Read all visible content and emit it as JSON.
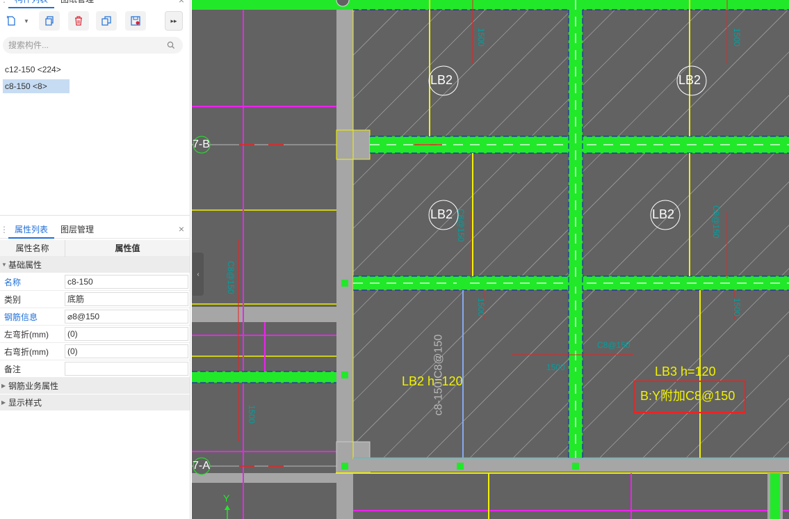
{
  "top_panel": {
    "tabs": [
      "构件列表",
      "图纸管理"
    ],
    "search_placeholder": "搜索构件...",
    "components": [
      {
        "label": "c12-150 <224>",
        "selected": false
      },
      {
        "label": "c8-150 <8>",
        "selected": true
      }
    ],
    "close": "×"
  },
  "prop_panel": {
    "tabs": [
      "属性列表",
      "图层管理"
    ],
    "close": "×",
    "header": {
      "name": "属性名称",
      "value": "属性值"
    },
    "group_basic": "基础属性",
    "rows": [
      {
        "name": "名称",
        "value": "c8-150",
        "blue": true
      },
      {
        "name": "类别",
        "value": "底筋",
        "blue": false
      },
      {
        "name": "钢筋信息",
        "value": "⌀8@150",
        "blue": true
      },
      {
        "name": "左弯折(mm)",
        "value": "(0)",
        "blue": false
      },
      {
        "name": "右弯折(mm)",
        "value": "(0)",
        "blue": false
      },
      {
        "name": "备注",
        "value": "",
        "blue": false
      }
    ],
    "group_business": "钢筋业务属性",
    "group_display": "显示样式"
  },
  "canvas": {
    "axis_labels": [
      "7-B",
      "7-A"
    ],
    "slab_labels": [
      "LB2",
      "LB2",
      "LB2",
      "LB2"
    ],
    "text_lb2": "LB2 h=120",
    "text_lb3": "LB3 h=120",
    "text_rebar_vertical": "c8-150:C8@150",
    "text_rebar_box": "B:Y附加C8@150",
    "y_axis": "Y",
    "colors": {
      "background": "#626262",
      "beam": "#a6a6a6",
      "green": "#22e82a",
      "yellow": "#f2f200",
      "magenta": "#ee22ee",
      "red_box": "#ee2222"
    }
  }
}
